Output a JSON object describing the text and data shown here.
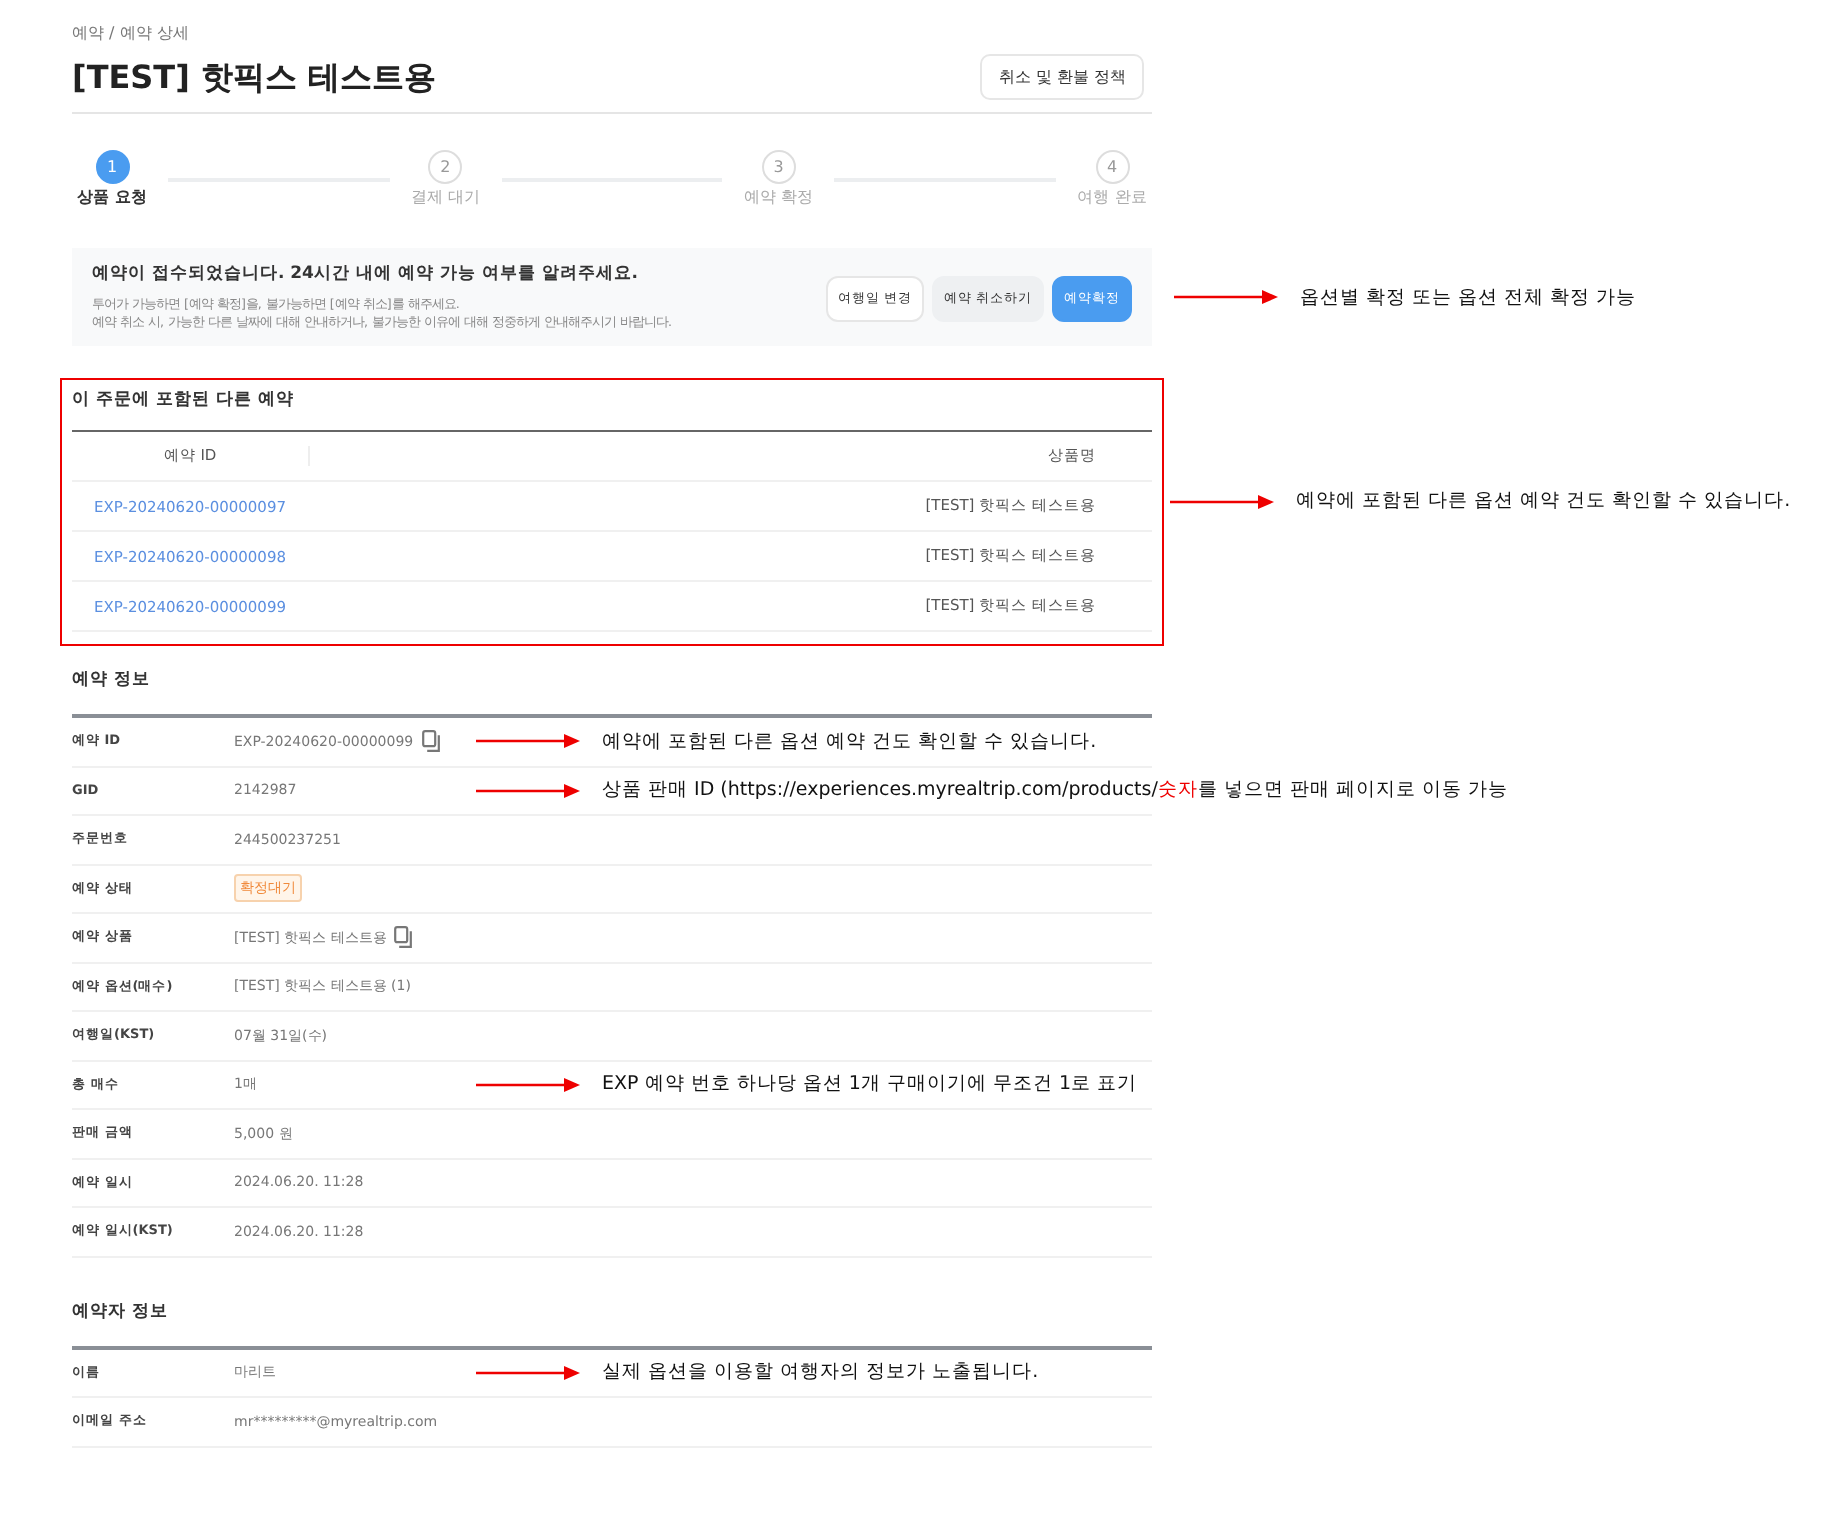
{
  "breadcrumb": "예약 / 예약 상세",
  "title": "[TEST] 핫픽스 테스트용",
  "header_button": "취소 및 환불 정책",
  "steps": [
    {
      "number": "1",
      "label": "상품 요청",
      "selected": true
    },
    {
      "number": "2",
      "label": "결제 대기",
      "selected": false
    },
    {
      "number": "3",
      "label": "예약 확정",
      "selected": false
    },
    {
      "number": "4",
      "label": "여행 완료",
      "selected": false
    }
  ],
  "notice": {
    "title": "예약이 접수되었습니다. 24시간 내에 예약 가능 여부를 알려주세요.",
    "lines": [
      "투어가 가능하면 [예약 확정]을, 불가능하면 [예약 취소]를 해주세요.",
      "예약 취소 시, 가능한 다른 날짜에 대해 안내하거나, 불가능한 이유에 대해 정중하게 안내해주시기 바랍니다."
    ],
    "buttons": [
      {
        "label": "여행일 변경",
        "kind": "outline"
      },
      {
        "label": "예약 취소하기",
        "kind": "gray"
      },
      {
        "label": "예약확정",
        "kind": "primary"
      }
    ],
    "annotation": [
      {
        "text": "옵션별 확정 또는 옵션 전체 확정 가능",
        "highlight": false
      }
    ]
  },
  "related": {
    "title": "이 주문에 포함된 다른 예약",
    "columns": [
      "예약 ID",
      "상품명"
    ],
    "rows": [
      [
        "EXP-20240620-00000097",
        "[TEST] 핫픽스 테스트용"
      ],
      [
        "EXP-20240620-00000098",
        "[TEST] 핫픽스 테스트용"
      ],
      [
        "EXP-20240620-00000099",
        "[TEST] 핫픽스 테스트용"
      ]
    ],
    "annotation": [
      {
        "text": "예약에 포함된 다른 옵션 예약 건도 확인할 수 있습니다.",
        "highlight": false
      }
    ]
  },
  "sections": [
    {
      "title": "예약 정보",
      "rows": [
        {
          "label": "예약 ID",
          "value": "EXP-20240620-00000099",
          "kind": "text",
          "copyable": true,
          "annotation": [
            {
              "text": "예약에 포함된 다른 옵션 예약 건도 확인할 수 있습니다.",
              "highlight": false
            }
          ]
        },
        {
          "label": "GID",
          "value": "2142987",
          "kind": "text",
          "copyable": false,
          "annotation": [
            {
              "text": "상품 판매 ID (https://experiences.myrealtrip.com/products/",
              "highlight": false
            },
            {
              "text": "숫자",
              "highlight": true
            },
            {
              "text": "를 넣으면 판매 페이지로 이동 가능",
              "highlight": false
            }
          ]
        },
        {
          "label": "주문번호",
          "value": "244500237251",
          "kind": "text",
          "copyable": false
        },
        {
          "label": "예약 상태",
          "value": "확정대기",
          "kind": "badge",
          "copyable": false
        },
        {
          "label": "예약 상품",
          "value": "[TEST] 핫픽스 테스트용",
          "kind": "text",
          "copyable": true
        },
        {
          "label": "예약 옵션(매수)",
          "value": "[TEST] 핫픽스 테스트용 (1)",
          "kind": "text",
          "copyable": false
        },
        {
          "label": "여행일(KST)",
          "value": "07월 31일(수)",
          "kind": "text",
          "copyable": false
        },
        {
          "label": "총 매수",
          "value": "1매",
          "kind": "text",
          "copyable": false,
          "annotation": [
            {
              "text": "EXP 예약 번호 하나당 옵션 1개 구매이기에 무조건 1로 표기",
              "highlight": false
            }
          ]
        },
        {
          "label": "판매 금액",
          "value": "5,000 원",
          "kind": "text",
          "copyable": false
        },
        {
          "label": "예약 일시",
          "value": "2024.06.20. 11:28",
          "kind": "text",
          "copyable": false
        },
        {
          "label": "예약 일시(KST)",
          "value": "2024.06.20. 11:28",
          "kind": "text",
          "copyable": false
        }
      ]
    },
    {
      "title": "예약자 정보",
      "rows": [
        {
          "label": "이름",
          "value": "마리트",
          "kind": "text",
          "copyable": false,
          "annotation": [
            {
              "text": "실제 옵션을 이용할 여행자의 정보가 노출됩니다.",
              "highlight": false
            }
          ]
        },
        {
          "label": "이메일 주소",
          "value": "mr*********@myrealtrip.com",
          "kind": "text",
          "copyable": false
        }
      ]
    }
  ]
}
